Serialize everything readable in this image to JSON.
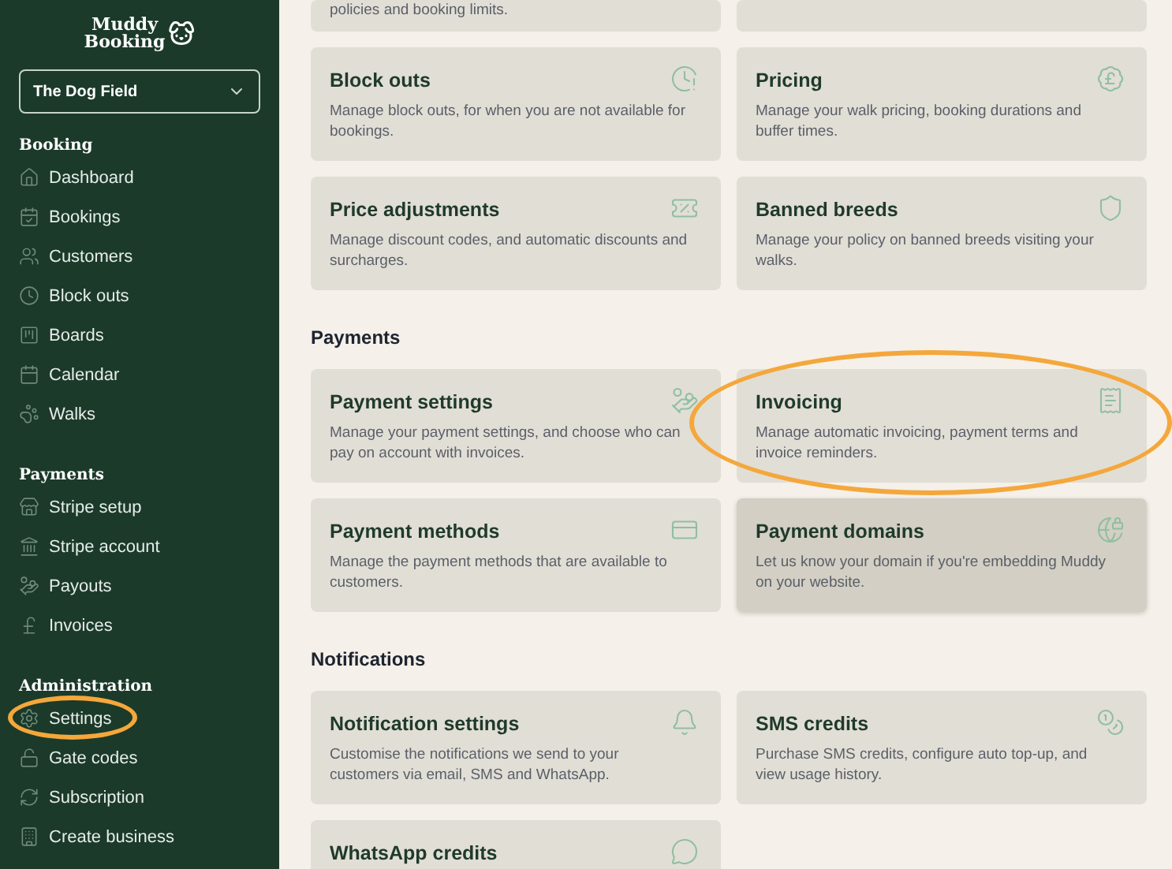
{
  "sidebar": {
    "logo": {
      "line_1": "Muddy",
      "line_2": "Booking"
    },
    "business_select": {
      "value": "The Dog Field"
    },
    "groups": [
      {
        "title": "Booking",
        "items": [
          {
            "label": "Dashboard",
            "circled": false
          },
          {
            "label": "Bookings",
            "circled": false
          },
          {
            "label": "Customers",
            "circled": false
          },
          {
            "label": "Block outs",
            "circled": false
          },
          {
            "label": "Boards",
            "circled": false
          },
          {
            "label": "Calendar",
            "circled": false
          },
          {
            "label": "Walks",
            "circled": false
          }
        ]
      },
      {
        "title": "Payments",
        "items": [
          {
            "label": "Stripe setup",
            "circled": false
          },
          {
            "label": "Stripe account",
            "circled": false
          },
          {
            "label": "Payouts",
            "circled": false
          },
          {
            "label": "Invoices",
            "circled": false
          }
        ]
      },
      {
        "title": "Administration",
        "items": [
          {
            "label": "Settings",
            "circled": true
          },
          {
            "label": "Gate codes",
            "circled": false
          },
          {
            "label": "Subscription",
            "circled": false
          },
          {
            "label": "Create business",
            "circled": false
          }
        ]
      }
    ]
  },
  "sections": [
    {
      "cards": [
        {
          "kind": "partial",
          "description": "policies and booking limits.",
          "hovered": false,
          "circled": false
        },
        {
          "kind": "partial",
          "hovered": false,
          "circled": false
        },
        {
          "kind": "full",
          "title": "Block outs",
          "description": "Manage block outs, for when you are not available for bookings.",
          "hovered": false,
          "circled": false
        },
        {
          "kind": "full",
          "title": "Pricing",
          "description": "Manage your walk pricing, booking durations and buffer times.",
          "hovered": false,
          "circled": false
        },
        {
          "kind": "full",
          "title": "Price adjustments",
          "description": "Manage discount codes, and automatic discounts and surcharges.",
          "hovered": false,
          "circled": false
        },
        {
          "kind": "full",
          "title": "Banned breeds",
          "description": "Manage your policy on banned breeds visiting your walks.",
          "hovered": false,
          "circled": false
        }
      ]
    },
    {
      "title": "Payments",
      "cards": [
        {
          "kind": "full",
          "title": "Payment settings",
          "description": "Manage your payment settings, and choose who can pay on account with invoices.",
          "hovered": false,
          "circled": false
        },
        {
          "kind": "full",
          "title": "Invoicing",
          "description": "Manage automatic invoicing, payment terms and invoice reminders.",
          "hovered": false,
          "circled": true
        },
        {
          "kind": "full",
          "title": "Payment methods",
          "description": "Manage the payment methods that are available to customers.",
          "hovered": false,
          "circled": false
        },
        {
          "kind": "full",
          "title": "Payment domains",
          "description": "Let us know your domain if you're embedding Muddy on your website.",
          "hovered": true,
          "circled": false
        }
      ]
    },
    {
      "title": "Notifications",
      "cards": [
        {
          "kind": "full",
          "title": "Notification settings",
          "description": "Customise the notifications we send to your customers via email, SMS and WhatsApp.",
          "hovered": false,
          "circled": false
        },
        {
          "kind": "full",
          "title": "SMS credits",
          "description": "Purchase SMS credits, configure auto top-up, and view usage history.",
          "hovered": false,
          "circled": false
        },
        {
          "kind": "full",
          "title": "WhatsApp credits",
          "hovered": false,
          "circled": false
        }
      ]
    }
  ]
}
